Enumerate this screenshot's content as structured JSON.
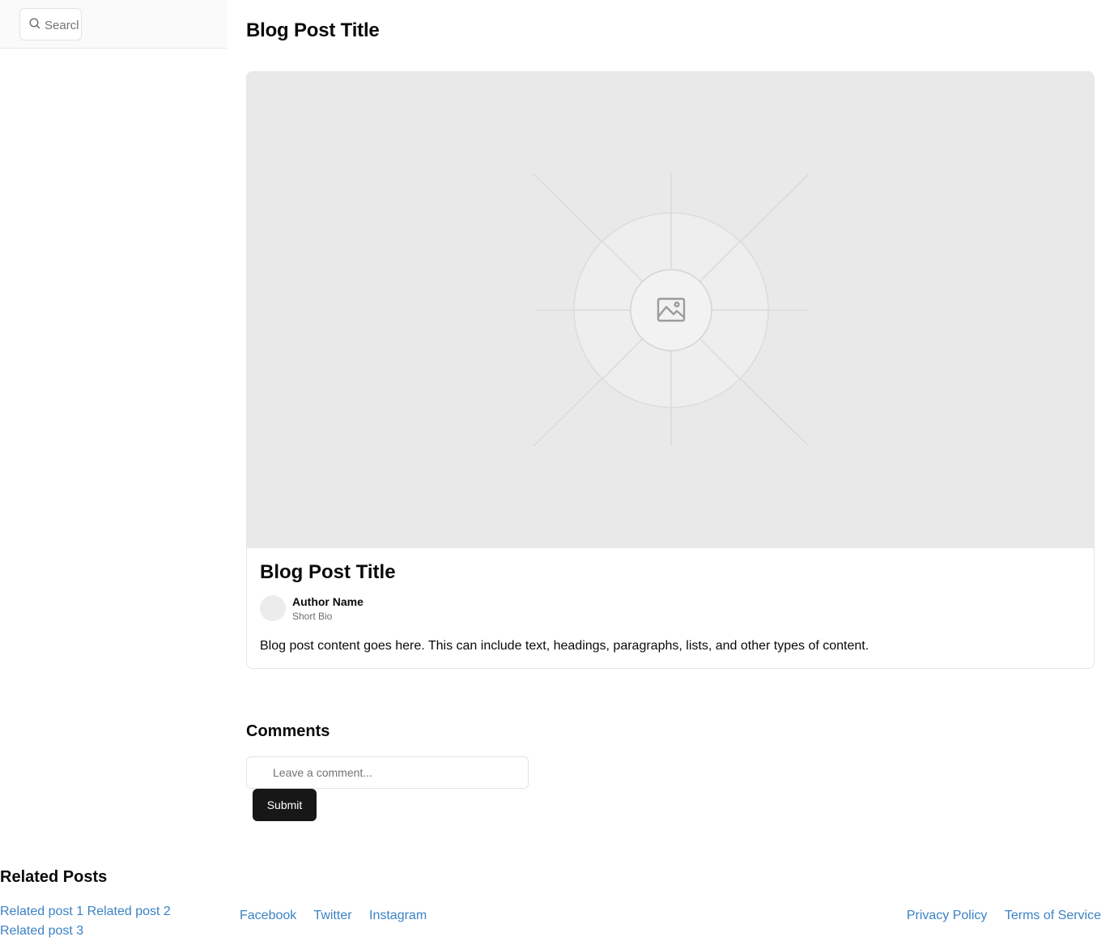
{
  "search": {
    "placeholder": "Search"
  },
  "page": {
    "title": "Blog Post Title"
  },
  "post": {
    "image_icon": "image-icon",
    "title": "Blog Post Title",
    "author_name": "Author Name",
    "author_bio": "Short Bio",
    "content": "Blog post content goes here. This can include text, headings, paragraphs, lists, and other types of content."
  },
  "comments": {
    "title": "Comments",
    "placeholder": "Leave a comment...",
    "submit_label": "Submit"
  },
  "related": {
    "title": "Related Posts",
    "items": [
      "Related post 1",
      "Related post 2",
      "Related post 3"
    ]
  },
  "footer": {
    "social": [
      "Facebook",
      "Twitter",
      "Instagram"
    ],
    "legal": [
      "Privacy Policy",
      "Terms of Service"
    ]
  },
  "colors": {
    "link": "#3b82c4",
    "button": "#171717",
    "placeholder_bg": "#e9e9e9"
  }
}
